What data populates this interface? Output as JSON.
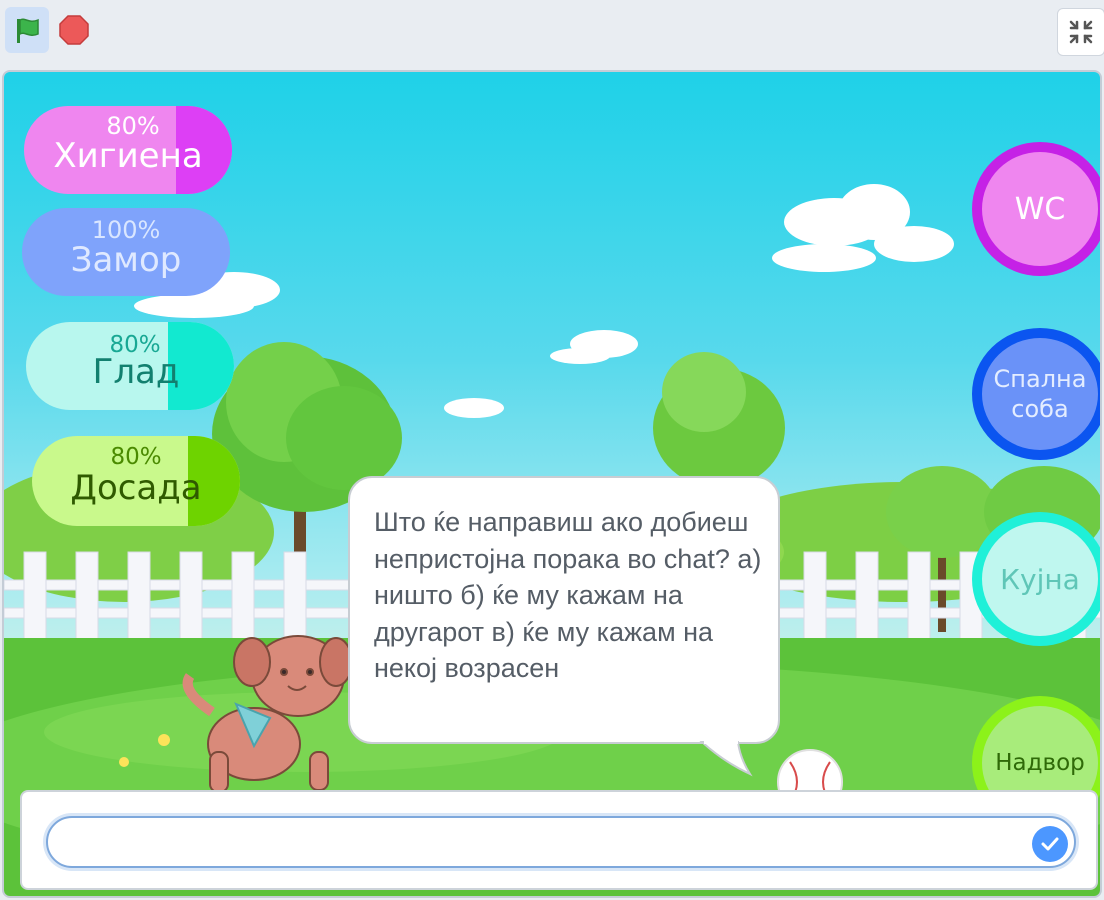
{
  "toolbar": {
    "green_flag_icon": "green-flag-icon",
    "stop_icon": "stop-icon",
    "fullscreen_icon": "exit-fullscreen-icon"
  },
  "stats": [
    {
      "key": "hygiene",
      "percent": "80%",
      "label": "Хигиена",
      "level": 0.8
    },
    {
      "key": "fatigue",
      "percent": "100%",
      "label": "Замор",
      "level": 1.0
    },
    {
      "key": "hunger",
      "percent": "80%",
      "label": "Глад",
      "level": 0.8
    },
    {
      "key": "boredom",
      "percent": "80%",
      "label": "Досада",
      "level": 0.8
    }
  ],
  "rooms": {
    "wc": "WC",
    "bedroom": "Спална соба",
    "kitchen": "Кујна",
    "outside": "Надвор"
  },
  "bubble": {
    "text": "Што ќе направиш ако добиеш непристојна порака во chat? а) ништо б) ќе му кажам на другарот в) ќе му кажам на некој возрасен"
  },
  "answer": {
    "value": ""
  },
  "colors": {
    "flag": "#3cb44b",
    "stop": "#ec5959",
    "submit": "#4c97ff"
  }
}
